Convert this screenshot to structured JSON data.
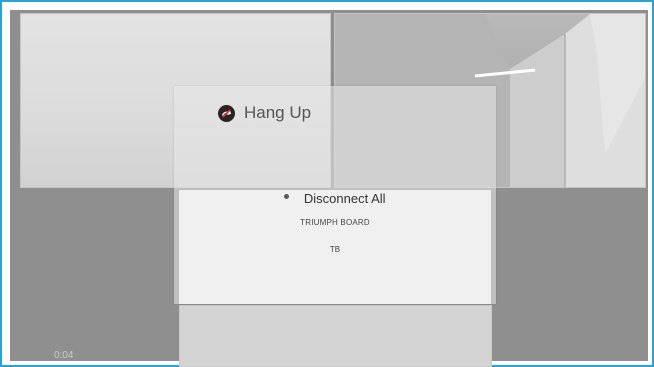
{
  "call": {
    "elapsed_time": "0:04"
  },
  "hangup_dialog": {
    "title": "Hang Up",
    "icon": "hang-up-icon",
    "options": [
      {
        "label": "Disconnect All",
        "selected": true
      },
      {
        "label": "TRIUMPH BOARD",
        "selected": false
      },
      {
        "label": "TB",
        "selected": false
      }
    ]
  },
  "colors": {
    "frame_border": "#29a3d6",
    "stage_background": "#8f8f8f",
    "icon_background": "#2a2323",
    "icon_accent": "#e0334c"
  }
}
